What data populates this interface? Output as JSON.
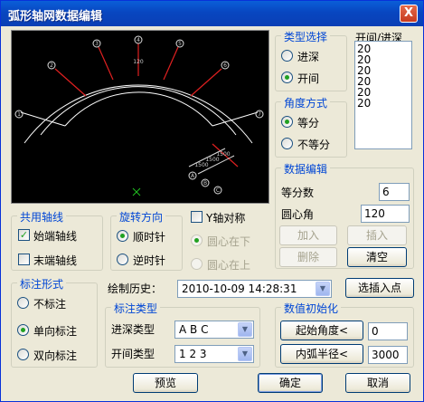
{
  "window": {
    "title": "弧形轴网数据编辑",
    "close": "X"
  },
  "preview": {
    "top_labels": [
      "1",
      "2",
      "3",
      "4",
      "5",
      "6",
      "7"
    ],
    "bottom_labels": [
      "A",
      "B",
      "C"
    ],
    "arc_label": "120",
    "dim_labels": [
      "1500",
      "1500",
      "1500"
    ]
  },
  "type_select": {
    "legend": "类型选择",
    "options": [
      {
        "label": "进深",
        "selected": false
      },
      {
        "label": "开间",
        "selected": true
      }
    ]
  },
  "spacing_list": {
    "header": "开间/进深",
    "items": [
      "20",
      "20",
      "20",
      "20",
      "20",
      "20"
    ]
  },
  "angle_mode": {
    "legend": "角度方式",
    "options": [
      {
        "label": "等分",
        "selected": true
      },
      {
        "label": "不等分",
        "selected": false
      }
    ]
  },
  "data_edit": {
    "legend": "数据编辑",
    "divisions_label": "等分数",
    "divisions_value": "6",
    "center_angle_label": "圆心角",
    "center_angle_value": "120",
    "add": "加入",
    "insert": "插入",
    "delete": "删除",
    "clear": "清空"
  },
  "shared_axis": {
    "legend": "共用轴线",
    "start_label": "始端轴线",
    "start_checked": true,
    "end_label": "末端轴线",
    "end_checked": false
  },
  "rotation": {
    "legend": "旋转方向",
    "options": [
      {
        "label": "顺时针",
        "selected": true
      },
      {
        "label": "逆时针",
        "selected": false
      }
    ]
  },
  "y_axis": {
    "label": "Y轴对称",
    "checked": false,
    "options": [
      {
        "label": "圆心在下",
        "selected": true
      },
      {
        "label": "圆心在上",
        "selected": false
      }
    ]
  },
  "annotation_form": {
    "legend": "标注形式",
    "options": [
      {
        "label": "不标注",
        "selected": false
      },
      {
        "label": "单向标注",
        "selected": true
      },
      {
        "label": "双向标注",
        "selected": false
      }
    ]
  },
  "history": {
    "label": "绘制历史：",
    "value": "2010-10-09 14:28:31",
    "insert_point": "选插入点"
  },
  "annotation_type": {
    "legend": "标注类型",
    "depth_label": "进深类型",
    "depth_value": "A B C",
    "bay_label": "开间类型",
    "bay_value": "1 2 3"
  },
  "init_values": {
    "legend": "数值初始化",
    "start_angle_btn": "起始角度<",
    "start_angle_value": "0",
    "inner_radius_btn": "内弧半径<",
    "inner_radius_value": "3000"
  },
  "footer": {
    "preview": "预览",
    "ok": "确定",
    "cancel": "取消"
  }
}
